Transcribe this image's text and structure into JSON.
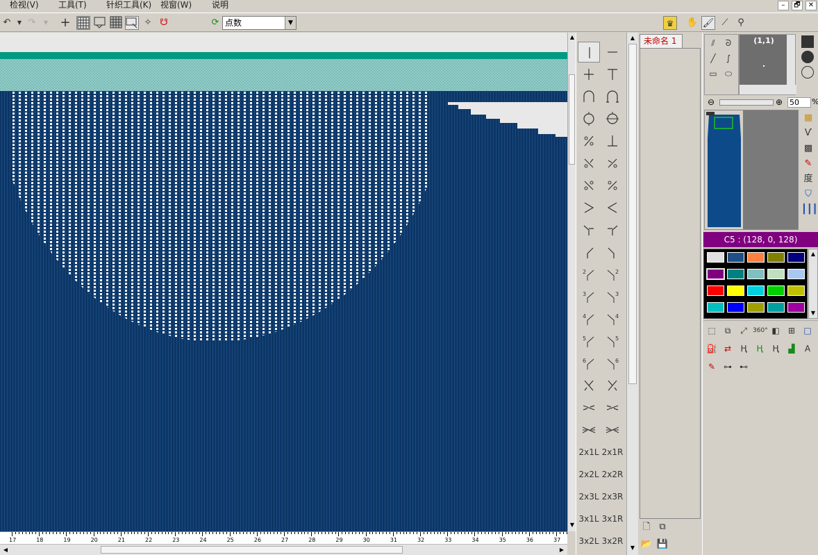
{
  "menu": [
    "检视(V)",
    "工具(T)",
    "针织工具(K)",
    "视窗(W)",
    "说明"
  ],
  "window_controls": [
    "–",
    "🗗",
    "✕"
  ],
  "toolbar": {
    "mode_value": "点数",
    "icons": [
      "undo-icon",
      "redo-icon",
      "crosshair-icon",
      "grid-icon",
      "select-icon",
      "pattern-icon",
      "marquee-icon",
      "lasso-icon",
      "magic-icon",
      "refresh-icon"
    ],
    "right_icons": [
      "crown-icon",
      "hand-icon",
      "brush-icon",
      "line-icon",
      "pick-icon"
    ]
  },
  "ruler_labels": [
    "17",
    "18",
    "19",
    "20",
    "21",
    "22",
    "23",
    "24",
    "25",
    "26",
    "27",
    "28",
    "29",
    "30",
    "31",
    "32",
    "33",
    "34",
    "35",
    "36",
    "37"
  ],
  "stitch_text_labels": [
    "2x1L",
    "2x1R",
    "2x2L",
    "2x2R",
    "2x3L",
    "2x3R",
    "3x1L",
    "3x1R",
    "3x2L",
    "3x2R"
  ],
  "document": {
    "tab_label": "未命名 1"
  },
  "preview": {
    "coord": "(1,1)"
  },
  "zoom": {
    "value": "50",
    "unit": "%"
  },
  "side_tools": [
    "layout-icon",
    "v-icon",
    "grid-block-icon",
    "pen-icon",
    "度",
    "shield-icon",
    "bars-icon"
  ],
  "current_color": {
    "label": "C5 : (128, 0, 128)",
    "hex": "#800080"
  },
  "palette_colors": [
    "#e0e0e0",
    "#1f4f86",
    "#ff8040",
    "#808000",
    "#000080",
    "#800080",
    "#008080",
    "#80c0c0",
    "#c0e0c0",
    "#a8c8f0",
    "#ff0000",
    "#ffff00",
    "#00d0e0",
    "#00d000",
    "#c0c000",
    "#00c0c0",
    "#0000ff",
    "#a0a000",
    "#00a0a0",
    "#a000a0"
  ],
  "canvas_colors": {
    "background": "#e8e8e8",
    "band_top": "#009a80",
    "band_rib": "#8cc8c4",
    "body": "#0c3666",
    "body_stripe": "#1a4a80",
    "ladder": "#ffffff"
  }
}
